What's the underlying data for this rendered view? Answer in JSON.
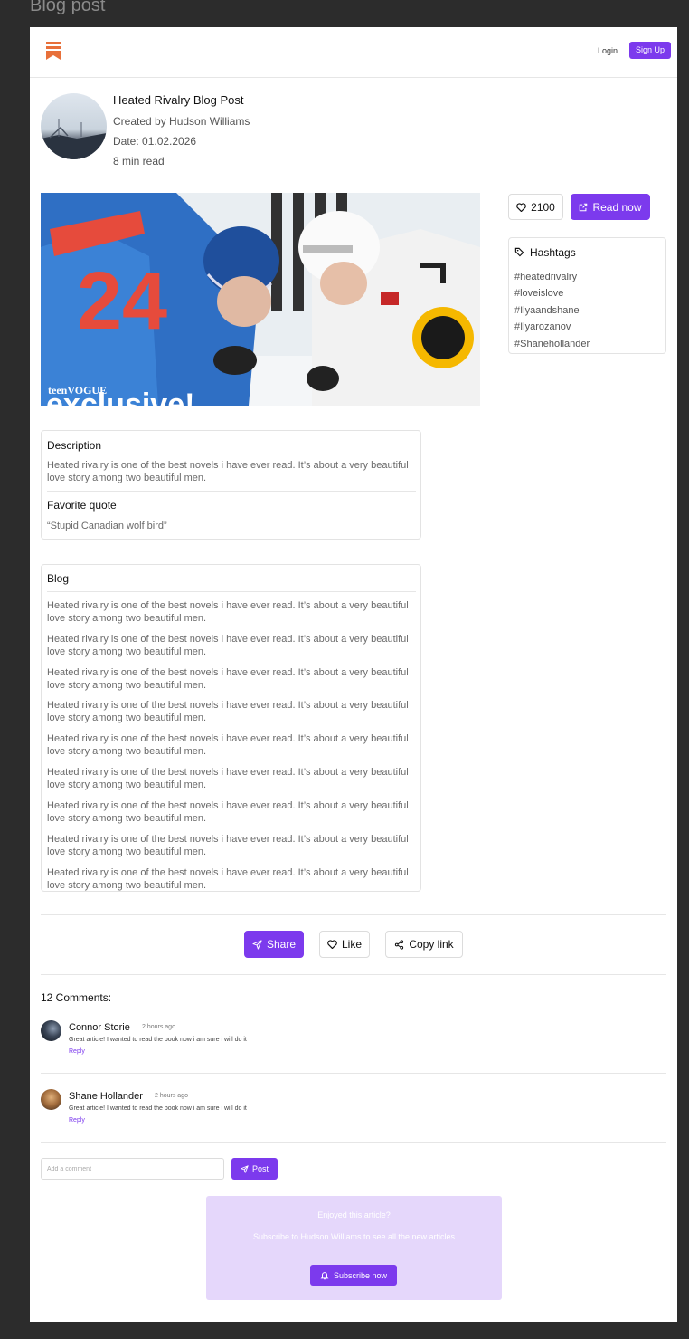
{
  "frame": {
    "label": "Blog post"
  },
  "nav": {
    "login_label": "Login",
    "signup_label": "Sign Up",
    "logo_icon": "bookmark-stack-icon"
  },
  "post": {
    "title": "Heated Rivalry Blog Post",
    "author_line": "Created by Hudson Williams",
    "date_line": "Date: 01.02.2026",
    "read_time": "8 min read",
    "image_overlay_brand": "teenVOGUE",
    "image_overlay_tag": "exclusive!",
    "jersey_number": "24"
  },
  "engagement": {
    "like_count": "2100",
    "read_now_label": "Read now"
  },
  "hashtags": {
    "title": "Hashtags",
    "items": [
      "#heatedrivalry",
      "#loveislove",
      "#Ilyaandshane",
      "#Ilyarozanov",
      "#Shanehollander"
    ]
  },
  "description": {
    "title": "Description",
    "text": "Heated rivalry is one of the best novels i have ever read. It’s about a very beautiful love story among two beautiful men.",
    "quote_title": "Favorite quote",
    "quote": "“Stupid Canadian wolf bird”"
  },
  "blog": {
    "title": "Blog",
    "paragraphs": [
      "Heated rivalry is one of the best novels i have ever read. It’s about a very beautiful love story among two beautiful men.",
      "Heated rivalry is one of the best novels i have ever read. It’s about a very beautiful love story among two beautiful men.",
      "Heated rivalry is one of the best novels i have ever read. It’s about a very beautiful love story among two beautiful men.",
      "Heated rivalry is one of the best novels i have ever read. It’s about a very beautiful love story among two beautiful men.",
      "Heated rivalry is one of the best novels i have ever read. It’s about a very beautiful love story among two beautiful men.",
      "Heated rivalry is one of the best novels i have ever read. It’s about a very beautiful love story among two beautiful men.",
      "Heated rivalry is one of the best novels i have ever read. It’s about a very beautiful love story among two beautiful men.",
      "Heated rivalry is one of the best novels i have ever read. It’s about a very beautiful love story among two beautiful men.",
      "Heated rivalry is one of the best novels i have ever read. It’s about a very beautiful love story among two beautiful men."
    ]
  },
  "actions": {
    "share_label": "Share",
    "like_label": "Like",
    "copy_label": "Copy link"
  },
  "comments": {
    "title": "12 Comments:",
    "items": [
      {
        "name": "Connor Storie",
        "time": "2 hours ago",
        "text": "Great article! I wanted to read the book now i am sure i will do it",
        "reply": "Reply"
      },
      {
        "name": "Shane Hollander",
        "time": "2 hours ago",
        "text": "Great article! I wanted to read the book now i am sure i will do it",
        "reply": "Reply"
      }
    ],
    "input_placeholder": "Add a comment",
    "post_label": "Post"
  },
  "subscribe": {
    "title": "Enjoyed this article?",
    "text": "Subscribe to Hudson Williams to see all the new articles",
    "button_label": "Subscribe now"
  },
  "colors": {
    "accent": "#7c3aed",
    "logo": "#e8703a",
    "subscribe_bg": "#e5d7fb"
  }
}
